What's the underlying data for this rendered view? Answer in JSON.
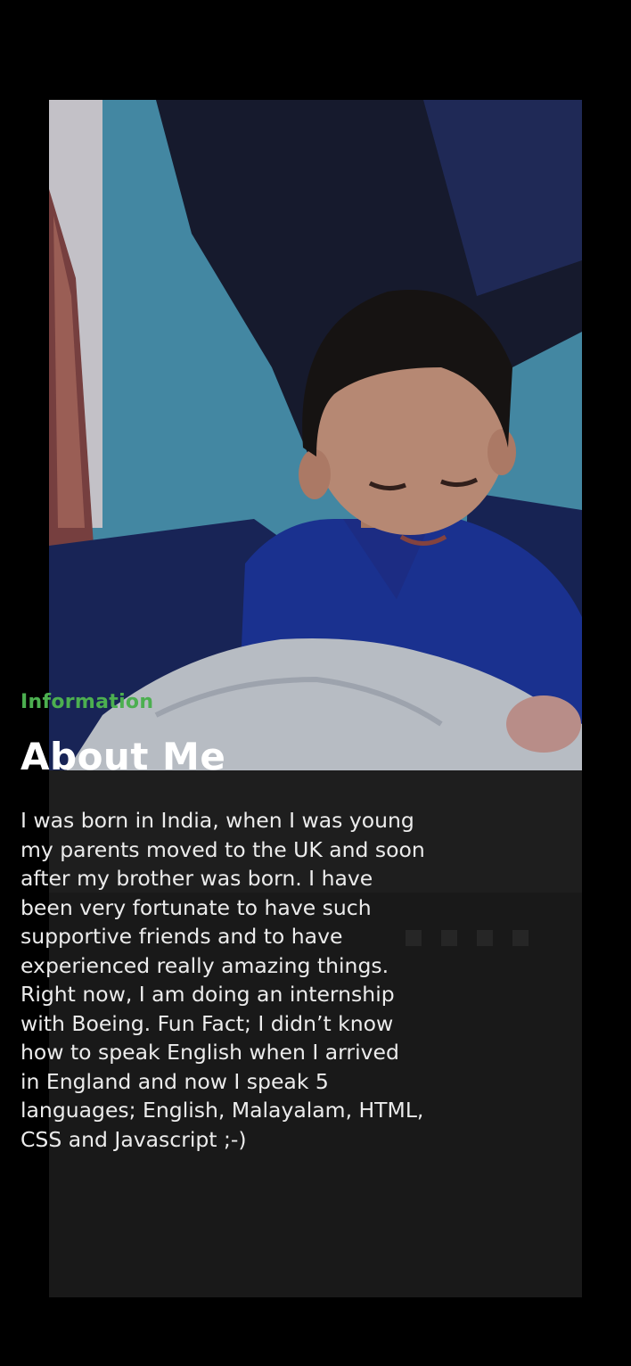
{
  "card": {
    "photo_alt": "photo of a young boy in a blue shirt smiling",
    "eyebrow": "Information",
    "title": "About Me",
    "bio": "I was born in India, when I was young\nmy parents moved to the UK and soon\nafter my brother was born. I have\nbeen very fortunate to have such\nsupportive friends and to have\nexperienced really amazing things.\nRight now, I am doing an internship\nwith Boeing. Fun Fact; I didn’t know\nhow to speak English when I arrived\nin England and now I speak 5\nlanguages; English, Malayalam, HTML,\nCSS and Javascript ;-)"
  },
  "colors": {
    "accent": "#4caf50",
    "background": "#000000",
    "card": "#191919"
  }
}
